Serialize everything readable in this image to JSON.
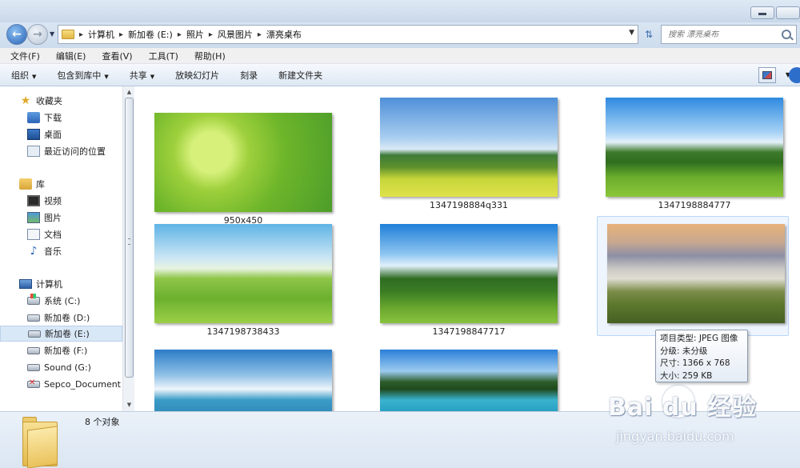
{
  "address": {
    "crumbs": [
      "计算机",
      "新加卷 (E:)",
      "照片",
      "风景图片",
      "漂亮桌布"
    ],
    "search_placeholder": "搜索 漂亮桌布"
  },
  "menu": [
    "文件(F)",
    "编辑(E)",
    "查看(V)",
    "工具(T)",
    "帮助(H)"
  ],
  "commands": [
    {
      "label": "组织",
      "dropdown": true
    },
    {
      "label": "包含到库中",
      "dropdown": true
    },
    {
      "label": "共享",
      "dropdown": true
    },
    {
      "label": "放映幻灯片",
      "dropdown": false
    },
    {
      "label": "刻录",
      "dropdown": false
    },
    {
      "label": "新建文件夹",
      "dropdown": false
    }
  ],
  "nav": {
    "favorites": {
      "label": "收藏夹",
      "items": [
        "下载",
        "桌面",
        "最近访问的位置"
      ]
    },
    "libraries": {
      "label": "库",
      "items": [
        "视频",
        "图片",
        "文档",
        "音乐"
      ]
    },
    "computer": {
      "label": "计算机",
      "items": [
        "系统 (C:)",
        "新加卷 (D:)",
        "新加卷 (E:)",
        "新加卷 (F:)",
        "Sound (G:)",
        "Sepco_Document (\\"
      ]
    },
    "selected": "新加卷 (E:)"
  },
  "files": [
    {
      "name": "950x450",
      "image": "green-bud"
    },
    {
      "name": "1347198884q331",
      "image": "field-tree"
    },
    {
      "name": "1347198884777",
      "image": "field-fence"
    },
    {
      "name": "1347198738433",
      "image": "green-field"
    },
    {
      "name": "1347198847717",
      "image": "field-fence-2"
    },
    {
      "name": "",
      "image": "tuscany-hills"
    },
    {
      "name": "",
      "image": "white-cliffs"
    },
    {
      "name": "",
      "image": "palm-pool"
    }
  ],
  "tooltip": {
    "type": "项目类型: JPEG 图像",
    "rating": "分级: 未分级",
    "dimensions": "尺寸: 1366 x 768",
    "size": "大小: 259 KB"
  },
  "status": {
    "count": "8 个对象"
  },
  "watermark": {
    "logo": "Bai du 经验",
    "url": "jingyan.baidu.com"
  }
}
